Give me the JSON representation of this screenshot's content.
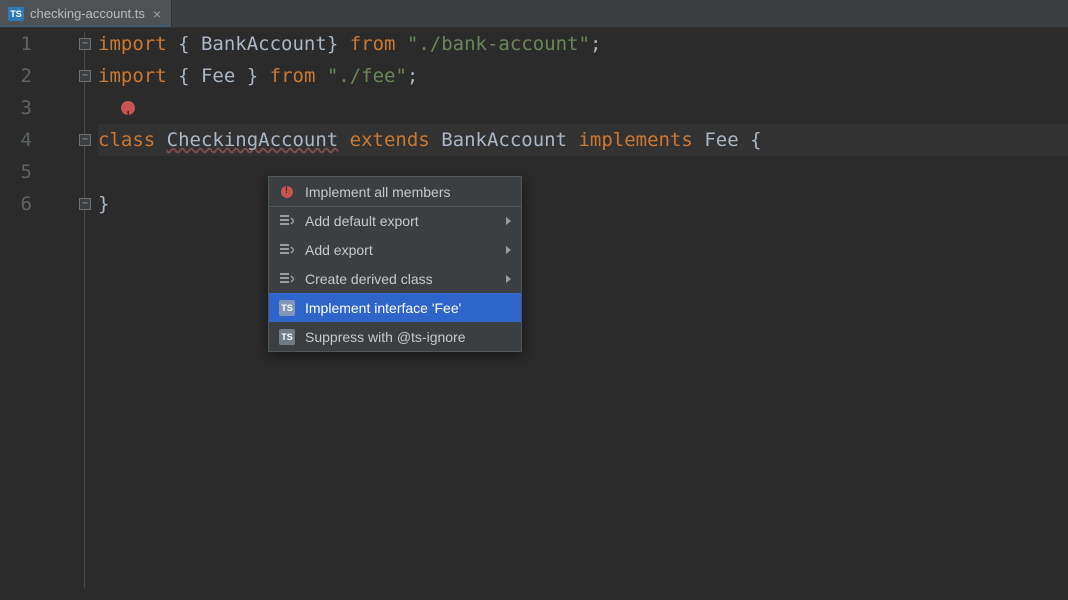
{
  "tab": {
    "filename": "checking-account.ts"
  },
  "gutter": [
    "1",
    "2",
    "3",
    "4",
    "5",
    "6"
  ],
  "code": {
    "l1": {
      "kw1": "import",
      "p1": " { ",
      "id": "BankAccount",
      "p2": "} ",
      "kw2": "from ",
      "str": "\"./bank-account\"",
      "end": ";"
    },
    "l2": {
      "kw1": "import",
      "p1": " { ",
      "id": "Fee",
      "p2": " } ",
      "kw2": "from ",
      "str": "\"./fee\"",
      "end": ";"
    },
    "l4": {
      "kw1": "class ",
      "name": "CheckingAccount",
      "kw2": " extends ",
      "base": "BankAccount",
      "kw3": " implements ",
      "iface": "Fee",
      "end": " {"
    },
    "l6": {
      "brace": "}"
    }
  },
  "menu": {
    "implement_all": "Implement all members",
    "add_default_export": "Add default export",
    "add_export": "Add export",
    "create_derived": "Create derived class",
    "implement_iface": "Implement interface 'Fee'",
    "suppress": "Suppress with @ts-ignore"
  }
}
